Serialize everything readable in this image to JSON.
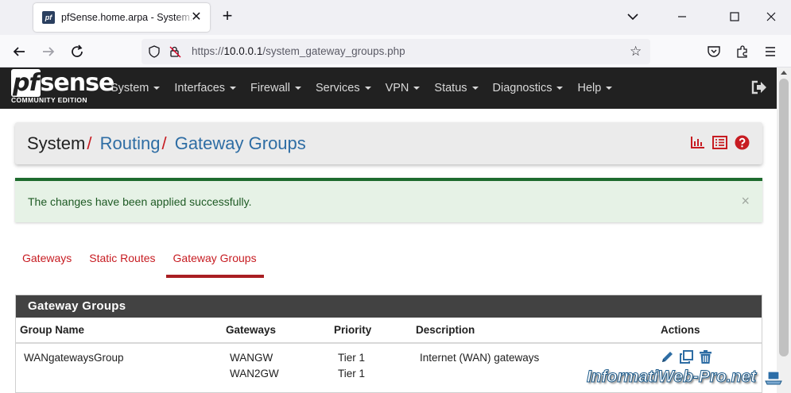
{
  "browser": {
    "tab_title": "pfSense.home.arpa - System: Routing: Gateway Groups",
    "favicon_text": "pf",
    "url_prefix": "https://",
    "url_host": "10.0.0.1",
    "url_path": "/system_gateway_groups.php"
  },
  "header": {
    "logo_main": "sense",
    "logo_pf": "pf",
    "logo_sub": "COMMUNITY EDITION",
    "menu": [
      "System",
      "Interfaces",
      "Firewall",
      "Services",
      "VPN",
      "Status",
      "Diagnostics",
      "Help"
    ]
  },
  "breadcrumb": {
    "root": "System",
    "sep": "/",
    "level1": "Routing",
    "level2": "Gateway Groups"
  },
  "alert": {
    "message": "The changes have been applied successfully.",
    "close": "×"
  },
  "tabs": [
    {
      "label": "Gateways",
      "active": false
    },
    {
      "label": "Static Routes",
      "active": false
    },
    {
      "label": "Gateway Groups",
      "active": true
    }
  ],
  "panel": {
    "title": "Gateway Groups",
    "columns": [
      "Group Name",
      "Gateways",
      "Priority",
      "Description",
      "Actions"
    ],
    "rows": [
      {
        "group_name": "WANgatewaysGroup",
        "gateways": [
          "WANGW",
          "WAN2GW"
        ],
        "priorities": [
          "Tier 1",
          "Tier 1"
        ],
        "description": "Internet (WAN) gateways"
      }
    ]
  },
  "watermark": "InformatiWeb-Pro.net",
  "colors": {
    "accent_red": "#c71c22",
    "link_blue": "#2e6da4",
    "header_dark": "#212121",
    "success_green": "#1e6b2e"
  }
}
